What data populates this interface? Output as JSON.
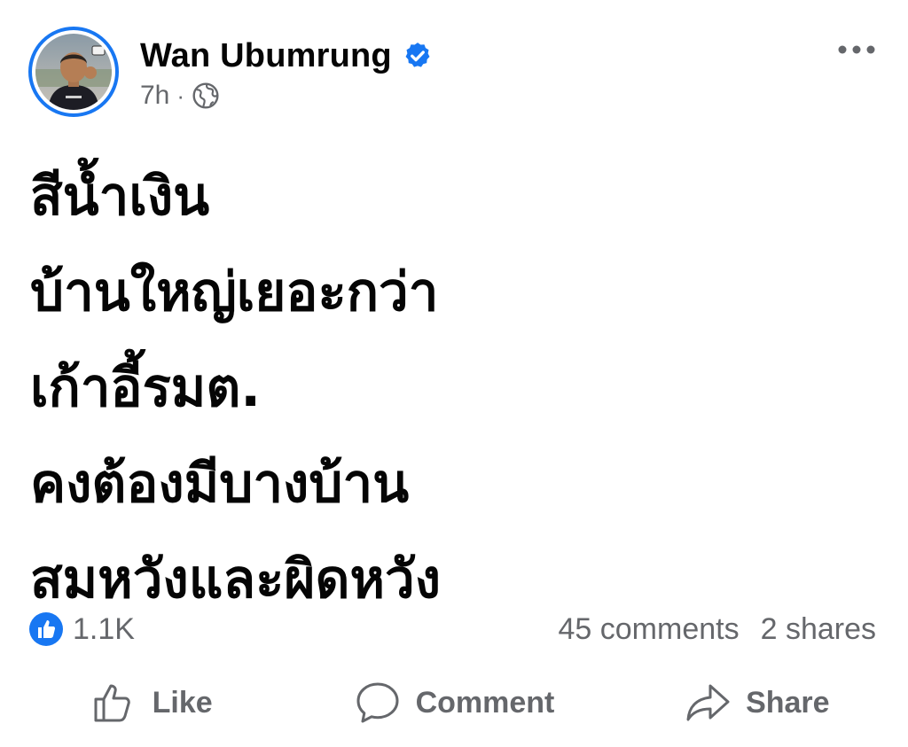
{
  "author": {
    "name": "Wan Ubumrung",
    "verified": true,
    "time": "7h",
    "separator": "·",
    "audience_icon": "globe-icon"
  },
  "post": {
    "lines": [
      "สีน้ำเงิน",
      "บ้านใหญ่เยอะกว่า",
      "เก้าอี้รมต.",
      "คงต้องมีบางบ้าน",
      "สมหวังและผิดหวัง"
    ]
  },
  "stats": {
    "reactions": "1.1K",
    "comments": "45 comments",
    "shares": "2 shares"
  },
  "actions": {
    "like": "Like",
    "comment": "Comment",
    "share": "Share"
  },
  "colors": {
    "brand": "#1877f2",
    "text": "#050505",
    "secondary": "#65676b"
  }
}
